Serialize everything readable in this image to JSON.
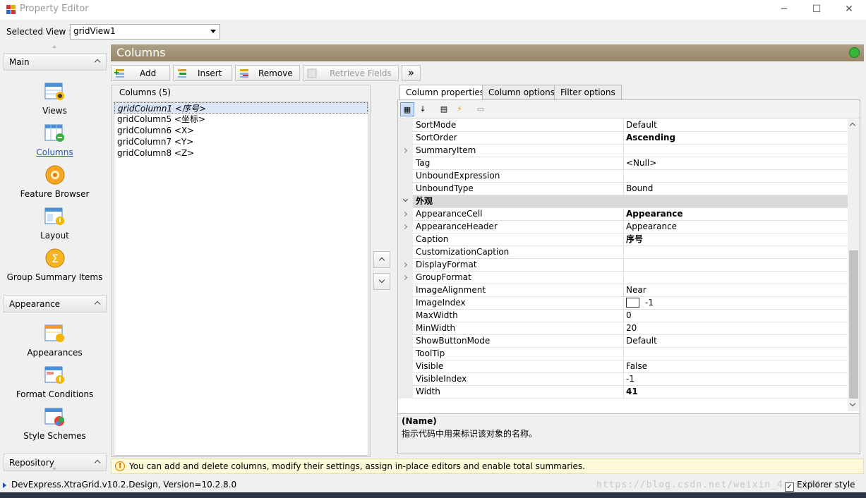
{
  "window": {
    "title": "Property Editor",
    "minimize": "─",
    "maximize": "☐",
    "close": "✕"
  },
  "selected_view": {
    "label": "Selected View :",
    "value": "gridView1"
  },
  "nav": {
    "groups": [
      {
        "label": "Main",
        "items": [
          {
            "label": "Views",
            "icon": "views-icon"
          },
          {
            "label": "Columns",
            "icon": "columns-icon",
            "selected": true
          },
          {
            "label": "Feature Browser",
            "icon": "feature-browser-icon"
          },
          {
            "label": "Layout",
            "icon": "layout-icon"
          },
          {
            "label": "Group Summary Items",
            "icon": "group-summary-icon"
          }
        ]
      },
      {
        "label": "Appearance",
        "items": [
          {
            "label": "Appearances",
            "icon": "appearances-icon"
          },
          {
            "label": "Format Conditions",
            "icon": "format-conditions-icon"
          },
          {
            "label": "Style Schemes",
            "icon": "style-schemes-icon"
          }
        ]
      },
      {
        "label": "Repository",
        "items": []
      }
    ]
  },
  "content": {
    "header": "Columns",
    "toolbar": {
      "add": "Add",
      "insert": "Insert",
      "remove": "Remove",
      "retrieve": "Retrieve Fields",
      "more": "»"
    },
    "columns_title": "Columns (5)",
    "columns": [
      "gridColumn1 <序号>",
      "gridColumn5 <坐标>",
      "gridColumn6 <X>",
      "gridColumn7 <Y>",
      "gridColumn8 <Z>"
    ],
    "tabs": [
      "Column properties",
      "Column options",
      "Filter options"
    ]
  },
  "properties": [
    {
      "name": "SortMode",
      "value": "Default"
    },
    {
      "name": "SortOrder",
      "value": "Ascending",
      "bold": true
    },
    {
      "name": "SummaryItem",
      "value": "",
      "expandable": true
    },
    {
      "name": "Tag",
      "value": "<Null>"
    },
    {
      "name": "UnboundExpression",
      "value": ""
    },
    {
      "name": "UnboundType",
      "value": "Bound"
    },
    {
      "name": "外观",
      "category": true
    },
    {
      "name": "AppearanceCell",
      "value": "Appearance",
      "expandable": true,
      "bold": true
    },
    {
      "name": "AppearanceHeader",
      "value": "Appearance",
      "expandable": true
    },
    {
      "name": "Caption",
      "value": "序号",
      "bold": true
    },
    {
      "name": "CustomizationCaption",
      "value": ""
    },
    {
      "name": "DisplayFormat",
      "value": "",
      "expandable": true
    },
    {
      "name": "GroupFormat",
      "value": "",
      "expandable": true
    },
    {
      "name": "ImageAlignment",
      "value": "Near"
    },
    {
      "name": "ImageIndex",
      "value": "-1",
      "swatch": true
    },
    {
      "name": "MaxWidth",
      "value": "0"
    },
    {
      "name": "MinWidth",
      "value": "20"
    },
    {
      "name": "ShowButtonMode",
      "value": "Default"
    },
    {
      "name": "ToolTip",
      "value": ""
    },
    {
      "name": "Visible",
      "value": "False"
    },
    {
      "name": "VisibleIndex",
      "value": "-1"
    },
    {
      "name": "Width",
      "value": "41",
      "bold": true
    }
  ],
  "description": {
    "title": "(Name)",
    "text": "指示代码中用来标识该对象的名称。"
  },
  "hint": "You can add and delete columns, modify their settings, assign in-place editors and enable total summaries.",
  "status": {
    "text": "DevExpress.XtraGrid.v10.2.Design, Version=10.2.8.0",
    "watermark": "https://blog.csdn.net/weixin_4...404...",
    "explorer_style": "Explorer style",
    "explorer_checked": true
  },
  "colors": {
    "header": "#a3957a",
    "selected_nav": "#2a56b5",
    "hint_bg": "#fbf9d8"
  }
}
